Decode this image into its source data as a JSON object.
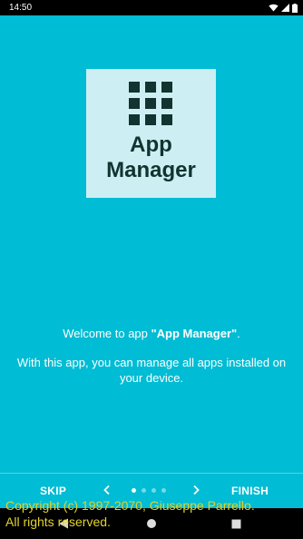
{
  "status_bar": {
    "time": "14:50",
    "icons": [
      "wifi-icon",
      "signal-icon",
      "battery-icon"
    ]
  },
  "logo": {
    "line1": "App",
    "line2": "Manager",
    "icon": "grid-icon"
  },
  "welcome": {
    "prefix": "Welcome to app ",
    "app_name": "\"App Manager\"",
    "suffix": "."
  },
  "description": "With this app, you can manage all apps installed on your device.",
  "pager": {
    "skip_label": "SKIP",
    "finish_label": "FINISH",
    "page_count": 4,
    "current_page": 1
  },
  "copyright": {
    "line1": "Copyright (c) 1997-2070, Giuseppe Parrello.",
    "line2": "All rights reserved."
  },
  "colors": {
    "background": "#00BCD4",
    "logo_bg": "#CDEFF3",
    "logo_fg": "#12332F",
    "copyright": "#E3D32A"
  }
}
